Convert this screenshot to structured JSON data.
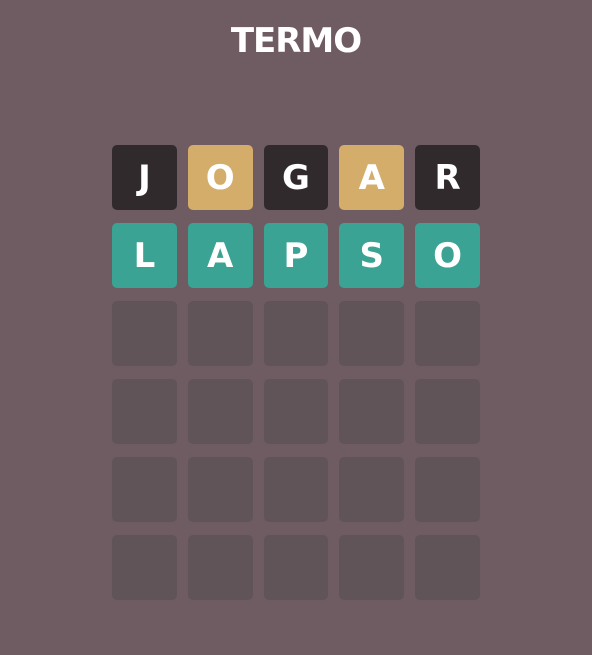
{
  "header": {
    "title": "TERMO"
  },
  "colors": {
    "background": "#6e5c62",
    "absent": "#312a2c",
    "present": "#d3ad69",
    "correct": "#3aa394",
    "empty": "#615458",
    "text": "#ffffff"
  },
  "board": {
    "rows": [
      [
        {
          "letter": "J",
          "state": "absent"
        },
        {
          "letter": "O",
          "state": "present"
        },
        {
          "letter": "G",
          "state": "absent"
        },
        {
          "letter": "A",
          "state": "present"
        },
        {
          "letter": "R",
          "state": "absent"
        }
      ],
      [
        {
          "letter": "L",
          "state": "correct"
        },
        {
          "letter": "A",
          "state": "correct"
        },
        {
          "letter": "P",
          "state": "correct"
        },
        {
          "letter": "S",
          "state": "correct"
        },
        {
          "letter": "O",
          "state": "correct"
        }
      ],
      [
        {
          "letter": "",
          "state": "empty"
        },
        {
          "letter": "",
          "state": "empty"
        },
        {
          "letter": "",
          "state": "empty"
        },
        {
          "letter": "",
          "state": "empty"
        },
        {
          "letter": "",
          "state": "empty"
        }
      ],
      [
        {
          "letter": "",
          "state": "empty"
        },
        {
          "letter": "",
          "state": "empty"
        },
        {
          "letter": "",
          "state": "empty"
        },
        {
          "letter": "",
          "state": "empty"
        },
        {
          "letter": "",
          "state": "empty"
        }
      ],
      [
        {
          "letter": "",
          "state": "empty"
        },
        {
          "letter": "",
          "state": "empty"
        },
        {
          "letter": "",
          "state": "empty"
        },
        {
          "letter": "",
          "state": "empty"
        },
        {
          "letter": "",
          "state": "empty"
        }
      ],
      [
        {
          "letter": "",
          "state": "empty"
        },
        {
          "letter": "",
          "state": "empty"
        },
        {
          "letter": "",
          "state": "empty"
        },
        {
          "letter": "",
          "state": "empty"
        },
        {
          "letter": "",
          "state": "empty"
        }
      ]
    ]
  }
}
